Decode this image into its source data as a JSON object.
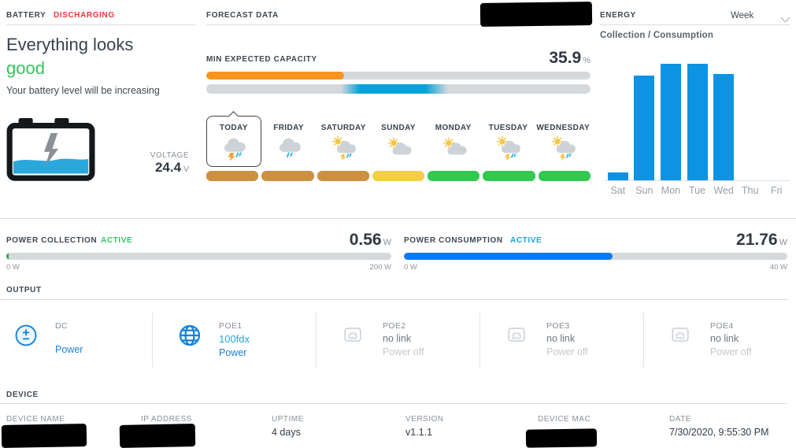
{
  "colors": {
    "accent_blue": "#1283da",
    "link_blue": "#1b80df",
    "poe_speed_blue": "#29a3e3",
    "chart_bar_blue": "#0c93e4",
    "consumption_bar_blue": "#0c79f2",
    "active_green": "#2fc462",
    "collection_green": "#26a94e",
    "alert_red": "#f0353c",
    "capacity_orange": "#f7941e",
    "capacity_window_blue": "#00a3d7",
    "pill_ochre": "#cd9040",
    "pill_yellow": "#f5cd4a",
    "pill_green": "#31c94f",
    "track_gray": "#d5d9dc"
  },
  "battery": {
    "section_title": "BATTERY",
    "status": "DISCHARGING",
    "headline_line1": "Everything looks",
    "headline_line2": "good",
    "subtitle": "Your battery level will be increasing",
    "icon": "battery-icon",
    "voltage_label": "VOLTAGE",
    "voltage_value": "24.4",
    "voltage_unit": "V"
  },
  "forecast": {
    "section_title": "FORECAST DATA",
    "capacity_label": "MIN EXPECTED CAPACITY",
    "capacity_value": "35.9",
    "capacity_unit": "%",
    "capacity_pct": 35.9,
    "window_start_pct": 35,
    "window_end_pct": 63,
    "days": [
      {
        "label": "TODAY",
        "icon": "storm-icon",
        "bar_color": "#cd9040",
        "selected": true
      },
      {
        "label": "FRIDAY",
        "icon": "rain-icon",
        "bar_color": "#cd9040",
        "selected": false
      },
      {
        "label": "SATURDAY",
        "icon": "sun-storm-icon",
        "bar_color": "#cd9040",
        "selected": false
      },
      {
        "label": "SUNDAY",
        "icon": "partly-cloudy-icon",
        "bar_color": "#f5cd4a",
        "selected": false
      },
      {
        "label": "MONDAY",
        "icon": "partly-cloudy-icon",
        "bar_color": "#31c94f",
        "selected": false
      },
      {
        "label": "TUESDAY",
        "icon": "sun-storm-icon",
        "bar_color": "#31c94f",
        "selected": false
      },
      {
        "label": "WEDNESDAY",
        "icon": "sun-storm-icon",
        "bar_color": "#31c94f",
        "selected": false
      }
    ]
  },
  "energy": {
    "section_title": "ENERGY",
    "period_selector": "Week",
    "period_chevron_icon": "chevron-down-icon",
    "subtitle": "Collection / Consumption"
  },
  "chart_data": {
    "type": "bar",
    "title": "Collection / Consumption",
    "categories": [
      "Sat",
      "Sun",
      "Mon",
      "Tue",
      "Wed",
      "Thu",
      "Fri"
    ],
    "values_pct": [
      7,
      90,
      100,
      100,
      91,
      0,
      0
    ],
    "bar_color": "#0c93e4",
    "xlabel": "",
    "ylabel": "",
    "y_axis_labeled": false,
    "grid": false,
    "legend_position": "none"
  },
  "power_collection": {
    "label": "POWER COLLECTION",
    "status": "ACTIVE",
    "value": "0.56",
    "unit": "W",
    "pct": 0.28,
    "min_label": "0 W",
    "max_label": "200 W"
  },
  "power_consumption": {
    "label": "POWER CONSUMPTION",
    "status": "ACTIVE",
    "value": "21.76",
    "unit": "W",
    "pct": 54.4,
    "min_label": "0 W",
    "max_label": "40 W"
  },
  "output": {
    "section_title": "OUTPUT",
    "ports": [
      {
        "name": "DC",
        "icon": "dc-icon",
        "value": "",
        "action": "Power",
        "state": "on"
      },
      {
        "name": "POE1",
        "icon": "globe-icon",
        "value": "100fdx",
        "action": "Power",
        "state": "on"
      },
      {
        "name": "POE2",
        "icon": "ethernet-icon",
        "value": "no link",
        "action": "Power off",
        "state": "off"
      },
      {
        "name": "POE3",
        "icon": "ethernet-icon",
        "value": "no link",
        "action": "Power off",
        "state": "off"
      },
      {
        "name": "POE4",
        "icon": "ethernet-icon",
        "value": "no link",
        "action": "Power off",
        "state": "off"
      }
    ]
  },
  "device": {
    "section_title": "DEVICE",
    "fields": [
      {
        "label": "DEVICE NAME",
        "value": "",
        "redacted": true
      },
      {
        "label": "IP ADDRESS",
        "value": "",
        "redacted": true
      },
      {
        "label": "UPTIME",
        "value": "4 days",
        "redacted": false
      },
      {
        "label": "VERSION",
        "value": "v1.1.1",
        "redacted": false
      },
      {
        "label": "DEVICE MAC",
        "value": "",
        "redacted": true
      },
      {
        "label": "DATE",
        "value": "7/30/2020, 9:55:30 PM",
        "redacted": false
      }
    ]
  }
}
